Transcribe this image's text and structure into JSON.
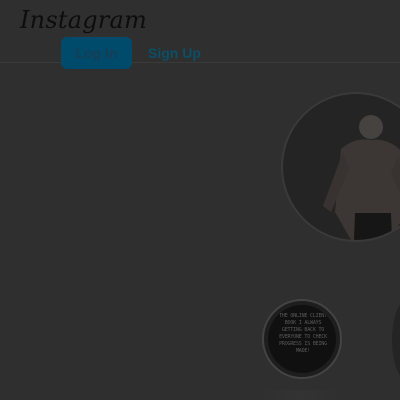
{
  "header": {
    "logo_text": "Instagram",
    "login_label": "Log In",
    "signup_label": "Sign Up"
  },
  "profile": {
    "image_alt": "profile photo"
  },
  "story": {
    "caption": "THE ONLINE CLIENT\nBOOK I ALWAYS\nGETTING BACK TO\nEVERYONE TO CHECK\nPROGRESS IS BEING\nMADE!"
  },
  "colors": {
    "background": "#2f2f2f",
    "logo": "#0d0d0d",
    "login_button": "#004a6c",
    "signup_link": "#0b4f68"
  }
}
